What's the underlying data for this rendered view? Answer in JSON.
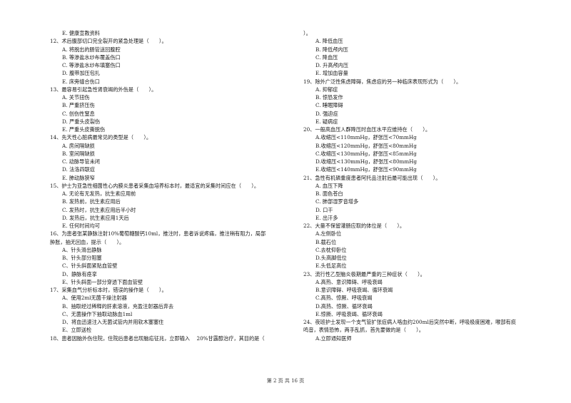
{
  "left_column": {
    "lines": [
      {
        "type": "opt",
        "text": "E. 健康宣教资料"
      },
      {
        "type": "q",
        "text": "12、术后腹部切口完全裂开的紧急处理是（　　）。"
      },
      {
        "type": "opt",
        "text": "A. 将脱出的肠管送回腹腔"
      },
      {
        "type": "opt",
        "text": "B. 等渗盐水纱布覆盖伤口"
      },
      {
        "type": "opt",
        "text": "C. 等渗盐水纱布填塞伤口"
      },
      {
        "type": "opt",
        "text": "D. 腹带加压包扎"
      },
      {
        "type": "opt",
        "text": "E. 床旁缝合伤口"
      },
      {
        "type": "q",
        "text": "13、最容易引起急性肾衰竭的外伤是（　　）。"
      },
      {
        "type": "opt",
        "text": "A.  关节扭伤"
      },
      {
        "type": "opt",
        "text": "B.  严重挤压伤"
      },
      {
        "type": "opt",
        "text": "C.  创伤性窒息"
      },
      {
        "type": "opt",
        "text": "D.  严重头皮裂伤"
      },
      {
        "type": "opt",
        "text": "E.  严重头皮撕脱伤"
      },
      {
        "type": "q",
        "text": "14、先天性心脏病最常见的类型是（　　）。"
      },
      {
        "type": "opt",
        "text": "A.  房间隔缺损"
      },
      {
        "type": "opt",
        "text": "B.  室间隔缺损"
      },
      {
        "type": "opt",
        "text": "C.  动脉导管未闭"
      },
      {
        "type": "opt",
        "text": "D.  法洛四联症"
      },
      {
        "type": "opt",
        "text": "E.  肺动脉狭窄"
      },
      {
        "type": "q",
        "text": "15、护士为亚急性细菌性心内膜炎患者采集血培养标本时，最适宜的采集时间应在（　　）。"
      },
      {
        "type": "opt",
        "text": "A.  无论有无发热，抗生素应用前"
      },
      {
        "type": "opt",
        "text": "B.  发热前，抗生素应用后"
      },
      {
        "type": "opt",
        "text": "C.  发热时，抗生素应用后半小时"
      },
      {
        "type": "opt",
        "text": "D.  发热后，抗生素应用1天后"
      },
      {
        "type": "opt",
        "text": "E.  任何时间均可"
      },
      {
        "type": "q",
        "text": "16、为患者张某静脉注射10%葡萄糖酸钙10ml，推注时，患者诉说疼痛，推注稍有阻力，局部"
      },
      {
        "type": "q",
        "text": "肿胀，抽无回血，提示（　　）。"
      },
      {
        "type": "opt",
        "text": "A、针头滑出静脉"
      },
      {
        "type": "opt",
        "text": "B、针头部分阻塞"
      },
      {
        "type": "opt",
        "text": "C、针头斜面紧贴血管壁"
      },
      {
        "type": "opt",
        "text": "D、静脉有痉挛"
      },
      {
        "type": "opt",
        "text": "E、针头斜面一部分穿透下面血管壁"
      },
      {
        "type": "q",
        "text": "17、采集血气分析标本时，错误的操作是（　　）。"
      },
      {
        "type": "opt",
        "text": "A、使用2ml无菌干燥注射器"
      },
      {
        "type": "opt",
        "text": "B、抽取经过稀释的肝素溶液，充盈注射器后弃去"
      },
      {
        "type": "opt",
        "text": "C、无菌操作下抽取动脉血1ml"
      },
      {
        "type": "opt",
        "text": "D、将血迅速注入无菌试管内并用软木塞塞住"
      },
      {
        "type": "opt",
        "text": "E、立即送检"
      },
      {
        "type": "q",
        "text": "18、患者因脑外伤住院，住院后患者出现脑疝征兆，立即输入　 20%甘露醇治疗，其目的是（"
      }
    ]
  },
  "right_column": {
    "lines": [
      {
        "type": "q",
        "text": "）。"
      },
      {
        "type": "opt",
        "text": "A.  降低血压"
      },
      {
        "type": "opt",
        "text": "B.  降低颅内压"
      },
      {
        "type": "opt",
        "text": "C.  降血压"
      },
      {
        "type": "opt",
        "text": "D.  升高颅内压"
      },
      {
        "type": "opt",
        "text": "E.  增加血容量"
      },
      {
        "type": "q",
        "text": "19、除外广泛性焦虑障碍，焦虑症的另一种临床表现形式为（　　）。"
      },
      {
        "type": "opt",
        "text": "A.  抑郁症"
      },
      {
        "type": "opt",
        "text": "B.  惊恐发作"
      },
      {
        "type": "opt",
        "text": "C.  睡眠障碍"
      },
      {
        "type": "opt",
        "text": "D.  强迫症"
      },
      {
        "type": "opt",
        "text": "E.  疑病症"
      },
      {
        "type": "q",
        "text": "20、一般高血压人群降压时血压水平应维持在（　　）。"
      },
      {
        "type": "opt",
        "text": "A.收缩压<110mmHg，舒张压<70mmHg"
      },
      {
        "type": "opt",
        "text": "B.收缩压<120mmHg，舒张压<80mmHg"
      },
      {
        "type": "opt",
        "text": "C.收缩压<130mmHg，舒张压<85mmHg"
      },
      {
        "type": "opt",
        "text": "D.收缩压<130mmHg，舒张压<80mmHg"
      },
      {
        "type": "opt",
        "text": "E.收缩压<140mmHg，舒张压<90mmHg"
      },
      {
        "type": "q",
        "text": "21、急性有机磷重度患者阿托品注射后最可能出现（　　）。"
      },
      {
        "type": "opt",
        "text": "A.  血压下降"
      },
      {
        "type": "opt",
        "text": "B.  面色苍白"
      },
      {
        "type": "opt",
        "text": "C.  肺部湿罗音增多"
      },
      {
        "type": "opt",
        "text": "D.  口干"
      },
      {
        "type": "opt",
        "text": "E.  出汗多"
      },
      {
        "type": "q",
        "text": "22、大量不保留灌肠应取的体位是（　　）。"
      },
      {
        "type": "opt",
        "text": "A.左侧卧位"
      },
      {
        "type": "opt",
        "text": "B.截石位"
      },
      {
        "type": "opt",
        "text": "C.去枕仰卧位"
      },
      {
        "type": "opt",
        "text": "D.头高脚低位"
      },
      {
        "type": "opt",
        "text": "E.头低足高位"
      },
      {
        "type": "q",
        "text": "23、流行性乙型脑炎极期最严重的三种症状（　　）。"
      },
      {
        "type": "opt",
        "text": "A.高热、意识障碍、呼吸衰竭"
      },
      {
        "type": "opt",
        "text": "B.意识障碍、呼吸衰竭、循环衰竭"
      },
      {
        "type": "opt",
        "text": "C.高热、惊厥、呼吸衰竭"
      },
      {
        "type": "opt",
        "text": "D.高热、惊厥、循环衰竭"
      },
      {
        "type": "opt",
        "text": "E.惊厥、呼吸衰竭、循环衰竭"
      },
      {
        "type": "q",
        "text": "24、夜班护士发现一个支气管扩张症病人咯血约200ml后突然中断，呼吸极度困难，喉部有痰"
      },
      {
        "type": "q",
        "text": "鸣音，表情恐怖，两手乱抓，首先要做的是（　　）。"
      },
      {
        "type": "opt",
        "text": "A.立即通知医师"
      }
    ]
  },
  "footer": {
    "page_label": "第 2 页 共 16 页"
  }
}
